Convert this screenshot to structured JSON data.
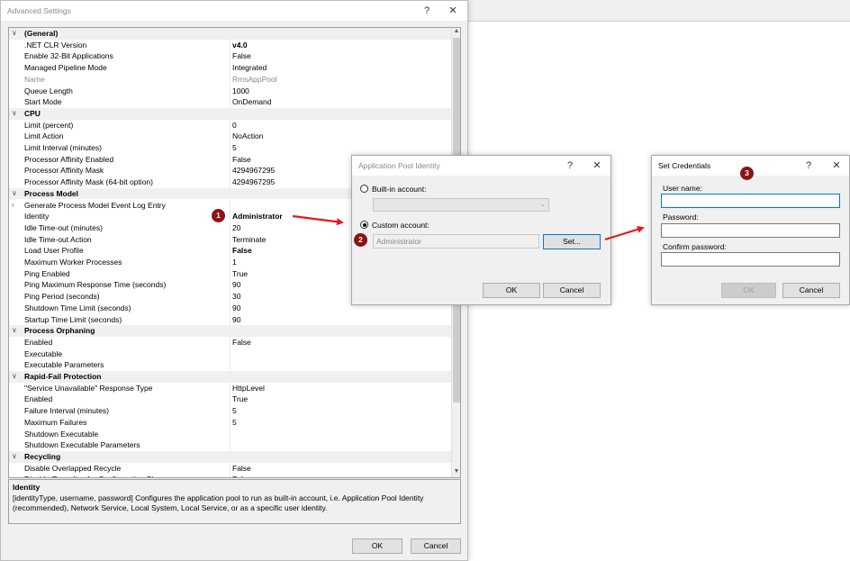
{
  "advanced": {
    "title": "Advanced Settings",
    "help": "?",
    "close": "✕",
    "rows": [
      {
        "type": "cat",
        "label": "(General)"
      },
      {
        "type": "prop",
        "label": ".NET CLR Version",
        "value": "v4.0",
        "bold": true
      },
      {
        "type": "prop",
        "label": "Enable 32-Bit Applications",
        "value": "False"
      },
      {
        "type": "prop",
        "label": "Managed Pipeline Mode",
        "value": "Integrated"
      },
      {
        "type": "prop",
        "label": "Name",
        "value": "RmsAppPool",
        "disabled": true
      },
      {
        "type": "prop",
        "label": "Queue Length",
        "value": "1000"
      },
      {
        "type": "prop",
        "label": "Start Mode",
        "value": "OnDemand"
      },
      {
        "type": "cat",
        "label": "CPU"
      },
      {
        "type": "prop",
        "label": "Limit (percent)",
        "value": "0"
      },
      {
        "type": "prop",
        "label": "Limit Action",
        "value": "NoAction"
      },
      {
        "type": "prop",
        "label": "Limit Interval (minutes)",
        "value": "5"
      },
      {
        "type": "prop",
        "label": "Processor Affinity Enabled",
        "value": "False"
      },
      {
        "type": "prop",
        "label": "Processor Affinity Mask",
        "value": "4294967295"
      },
      {
        "type": "prop",
        "label": "Processor Affinity Mask (64-bit option)",
        "value": "4294967295"
      },
      {
        "type": "cat",
        "label": "Process Model"
      },
      {
        "type": "prop",
        "label": "Generate Process Model Event Log Entry",
        "value": "",
        "expander": true
      },
      {
        "type": "prop",
        "label": "Identity",
        "value": "Administrator",
        "bold": true
      },
      {
        "type": "prop",
        "label": "Idle Time-out (minutes)",
        "value": "20"
      },
      {
        "type": "prop",
        "label": "Idle Time-out Action",
        "value": "Terminate"
      },
      {
        "type": "prop",
        "label": "Load User Profile",
        "value": "False",
        "bold": true
      },
      {
        "type": "prop",
        "label": "Maximum Worker Processes",
        "value": "1"
      },
      {
        "type": "prop",
        "label": "Ping Enabled",
        "value": "True"
      },
      {
        "type": "prop",
        "label": "Ping Maximum Response Time (seconds)",
        "value": "90"
      },
      {
        "type": "prop",
        "label": "Ping Period (seconds)",
        "value": "30"
      },
      {
        "type": "prop",
        "label": "Shutdown Time Limit (seconds)",
        "value": "90"
      },
      {
        "type": "prop",
        "label": "Startup Time Limit (seconds)",
        "value": "90"
      },
      {
        "type": "cat",
        "label": "Process Orphaning"
      },
      {
        "type": "prop",
        "label": "Enabled",
        "value": "False"
      },
      {
        "type": "prop",
        "label": "Executable",
        "value": ""
      },
      {
        "type": "prop",
        "label": "Executable Parameters",
        "value": ""
      },
      {
        "type": "cat",
        "label": "Rapid-Fail Protection"
      },
      {
        "type": "prop",
        "label": "\"Service Unavailable\" Response Type",
        "value": "HttpLevel"
      },
      {
        "type": "prop",
        "label": "Enabled",
        "value": "True"
      },
      {
        "type": "prop",
        "label": "Failure Interval (minutes)",
        "value": "5"
      },
      {
        "type": "prop",
        "label": "Maximum Failures",
        "value": "5"
      },
      {
        "type": "prop",
        "label": "Shutdown Executable",
        "value": ""
      },
      {
        "type": "prop",
        "label": "Shutdown Executable Parameters",
        "value": ""
      },
      {
        "type": "cat",
        "label": "Recycling"
      },
      {
        "type": "prop",
        "label": "Disable Overlapped Recycle",
        "value": "False"
      },
      {
        "type": "prop",
        "label": "Disable Recycling for Configuration Changes",
        "value": "False"
      }
    ],
    "desc_title": "Identity",
    "desc_text": "[identityType, username, password] Configures the application pool to run as built-in account, i.e. Application Pool Identity (recommended), Network Service, Local System, Local Service, or as a specific user identity.",
    "ok": "OK",
    "cancel": "Cancel"
  },
  "app_pool_identity": {
    "title": "Application Pool Identity",
    "help": "?",
    "close": "✕",
    "builtin_label": "Built-in account:",
    "builtin_value": "",
    "custom_label": "Custom account:",
    "custom_value": "Administrator",
    "set_label": "Set...",
    "ok": "OK",
    "cancel": "Cancel",
    "selected": "custom"
  },
  "set_credentials": {
    "title": "Set Credentials",
    "help": "?",
    "close": "✕",
    "username_label": "User name:",
    "username_value": "",
    "password_label": "Password:",
    "confirm_label": "Confirm password:",
    "ok": "OK",
    "cancel": "Cancel"
  },
  "callouts": {
    "one": "1",
    "two": "2",
    "three": "3"
  },
  "colors": {
    "callout": "#8b1414",
    "arrow": "#e8161b",
    "accent": "#0078d7"
  }
}
